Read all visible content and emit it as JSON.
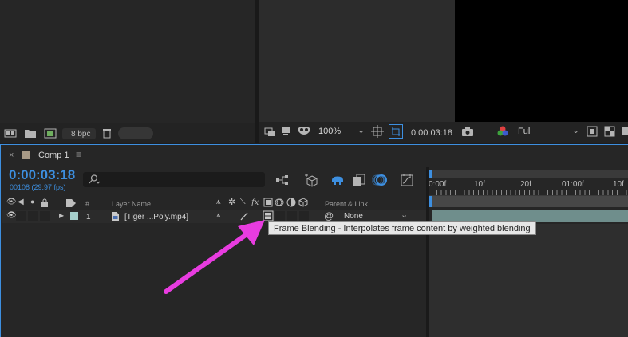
{
  "project_panel": {
    "bpc_label": "8 bpc"
  },
  "viewer": {
    "zoom": "100%",
    "timecode": "0:00:03:18",
    "resolution": "Full"
  },
  "timeline": {
    "tab_label": "Comp 1",
    "current_time": "0:00:03:18",
    "frame_info": "00108 (29.97 fps)",
    "search_placeholder": "",
    "columns": {
      "number": "#",
      "layer_name": "Layer Name",
      "parent_link": "Parent & Link"
    },
    "layers": [
      {
        "number": "1",
        "name": "[Tiger ...Poly.mp4]",
        "parent": "None",
        "label_color": "#a6cfcc"
      }
    ],
    "ruler_ticks": [
      "0:00f",
      "10f",
      "20f",
      "01:00f",
      "10f"
    ]
  },
  "tooltip": {
    "text": "Frame Blending - Interpolates frame content by weighted blending"
  },
  "colors": {
    "accent_blue": "#3d8fe0",
    "layer_bar": "#6f8e8c",
    "annotation_arrow": "#e83ce0"
  },
  "icons": [
    "folder-icon",
    "trash-icon",
    "camera-icon",
    "search-icon",
    "eye-icon",
    "lock-icon",
    "label-icon",
    "fx-icon",
    "frame-blending-icon",
    "parent-pickwhip-icon"
  ]
}
